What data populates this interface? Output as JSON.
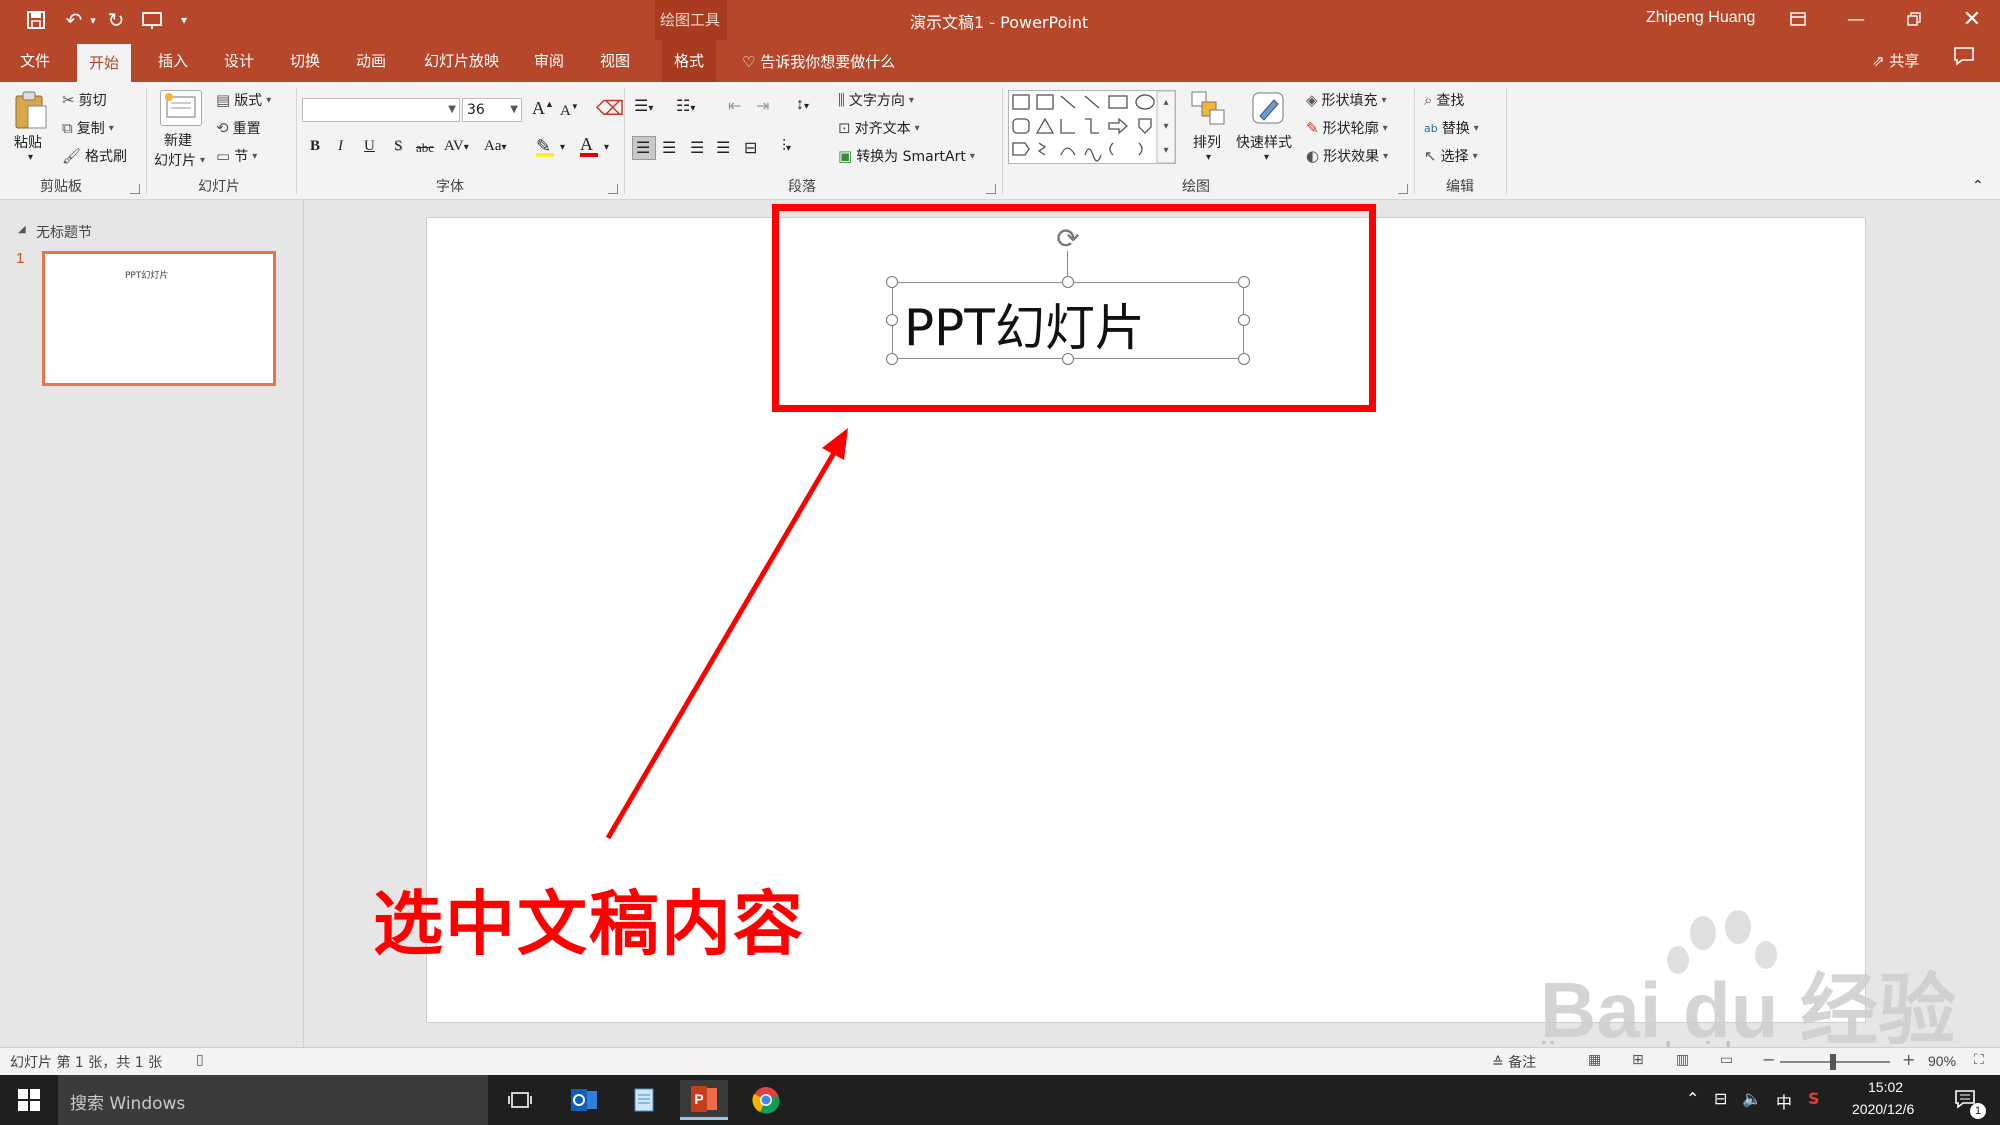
{
  "app": {
    "doc_title": "演示文稿1  -  PowerPoint",
    "context_tab_title": "绘图工具",
    "user_name": "Zhipeng Huang"
  },
  "colors": {
    "accent": "#b7472a",
    "annotation": "#ff0000",
    "thumb_border": "#e8734d"
  },
  "menu": {
    "tabs": [
      "文件",
      "开始",
      "插入",
      "设计",
      "切换",
      "动画",
      "幻灯片放映",
      "审阅",
      "视图",
      "格式"
    ],
    "active_tab": "开始",
    "tell_me": "告诉我你想要做什么",
    "share": "共享"
  },
  "ribbon": {
    "clipboard": {
      "paste": "粘贴",
      "cut": "剪切",
      "copy": "复制",
      "format_painter": "格式刷",
      "label": "剪贴板"
    },
    "slides": {
      "new_slide_1": "新建",
      "new_slide_2": "幻灯片",
      "layout": "版式",
      "reset": "重置",
      "section": "节",
      "label": "幻灯片"
    },
    "font": {
      "font_name": "",
      "font_size": "36",
      "label": "字体",
      "bold": "B",
      "italic": "I",
      "underline": "U",
      "shadow": "S",
      "strike": "abc",
      "spacing": "AV",
      "case": "Aa",
      "grow": "A",
      "shrink": "A"
    },
    "paragraph": {
      "text_direction": "文字方向",
      "align_text": "对齐文本",
      "smartart": "转换为 SmartArt",
      "label": "段落"
    },
    "drawing": {
      "arrange": "排列",
      "quick_styles": "快速样式",
      "shape_fill": "形状填充",
      "shape_outline": "形状轮廓",
      "shape_effects": "形状效果",
      "label": "绘图"
    },
    "editing": {
      "find": "查找",
      "replace": "替换",
      "select": "选择",
      "label": "编辑"
    }
  },
  "slides_pane": {
    "section_name": "无标题节",
    "slide_number": "1",
    "thumb_text": "PPT幻灯片"
  },
  "slide": {
    "title_text": "PPT幻灯片"
  },
  "annotation": {
    "text": "选中文稿内容"
  },
  "watermark": {
    "brand": "Bai du 经验",
    "url": "jingyan.baidu.com"
  },
  "status": {
    "slide_info": "幻灯片 第 1 张，共 1 张",
    "notes": "备注",
    "zoom": "90%"
  },
  "taskbar": {
    "search_placeholder": "搜索 Windows",
    "time": "15:02",
    "date": "2020/12/6",
    "ime": "中",
    "notification_count": "1"
  }
}
